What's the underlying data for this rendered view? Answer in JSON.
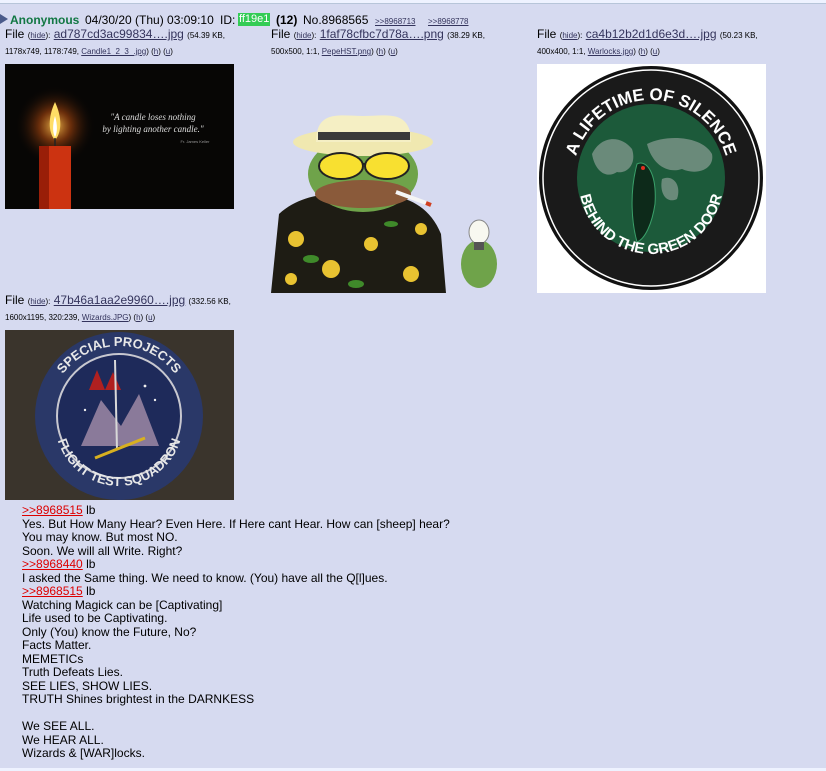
{
  "post": {
    "name": "Anonymous",
    "datetime": "04/30/20 (Thu) 03:09:10",
    "id_label": "ID:",
    "id_value": "ff19e1",
    "post_count": "(12)",
    "post_number": "No.8968565",
    "backlinks": [
      ">>8968713",
      ">>8968778"
    ]
  },
  "files": [
    {
      "label": "File",
      "hide_label": "hide",
      "filename": "ad787cd3ac99834….jpg",
      "size": "54.39 KB,",
      "meta": "1178x749, 1178:749,",
      "original_name": "Candle1_2_3_.jpg",
      "h_link": "h",
      "u_link": "u",
      "thumb_text": "\"A candle loses nothing by lighting another candle.\"",
      "thumb_attribution": "Fr. James Keller"
    },
    {
      "label": "File",
      "hide_label": "hide",
      "filename": "1faf78cfbc7d78a….png",
      "size": "38.29 KB,",
      "meta": "500x500, 1:1,",
      "original_name": "PepeHST.png",
      "h_link": "h",
      "u_link": "u"
    },
    {
      "label": "File",
      "hide_label": "hide",
      "filename": "ca4b12b2d1d6e3d….jpg",
      "size": "50.23 KB,",
      "meta": "400x400, 1:1,",
      "original_name": "Warlocks.jpg",
      "h_link": "h",
      "u_link": "u",
      "patch_top": "A LIFETIME OF SILENCE",
      "patch_bottom": "BEHIND THE GREEN DOOR"
    },
    {
      "label": "File",
      "hide_label": "hide",
      "filename": "47b46a1aa2e9960….jpg",
      "size": "332.56 KB,",
      "meta": "1600x1195, 320:239,",
      "original_name": "Wizards.JPG",
      "h_link": "h",
      "u_link": "u",
      "patch_top": "SPECIAL PROJECTS",
      "patch_bottom": "FLIGHT TEST SQUADRON"
    }
  ],
  "message": [
    {
      "type": "quote",
      "link": ">>8968515",
      "after": " lb"
    },
    {
      "type": "text",
      "text": "Yes. But How Many Hear? Even Here. If Here cant Hear. How can [sheep] hear?"
    },
    {
      "type": "text",
      "text": "You may know. But most NO."
    },
    {
      "type": "text",
      "text": "Soon. We will all Write. Right?"
    },
    {
      "type": "quote",
      "link": ">>8968440",
      "after": " lb"
    },
    {
      "type": "text",
      "text": "I asked the Same thing. We need to know. (You) have all the Q[l]ues."
    },
    {
      "type": "quote",
      "link": ">>8968515",
      "after": " lb"
    },
    {
      "type": "text",
      "text": "Watching Magick can be [Captivating]"
    },
    {
      "type": "text",
      "text": "Life used to be Captivating."
    },
    {
      "type": "text",
      "text": "Only (You) know the Future, No?"
    },
    {
      "type": "text",
      "text": "Facts Matter."
    },
    {
      "type": "text",
      "text": "MEMETICs"
    },
    {
      "type": "text",
      "text": "Truth Defeats Lies."
    },
    {
      "type": "text",
      "text": "SEE LIES, SHOW LIES."
    },
    {
      "type": "text",
      "text": "TRUTH Shines brightest in the DARNKESS"
    },
    {
      "type": "text",
      "text": ""
    },
    {
      "type": "text",
      "text": "We SEE ALL."
    },
    {
      "type": "text",
      "text": "We HEAR ALL."
    },
    {
      "type": "text",
      "text": "Wizards & [WAR]locks."
    }
  ],
  "colors": {
    "post_bg": "#d6daf0",
    "name": "#117743",
    "link": "#34345c",
    "quote_link": "#dd0000",
    "id_badge": "#33cc55"
  }
}
